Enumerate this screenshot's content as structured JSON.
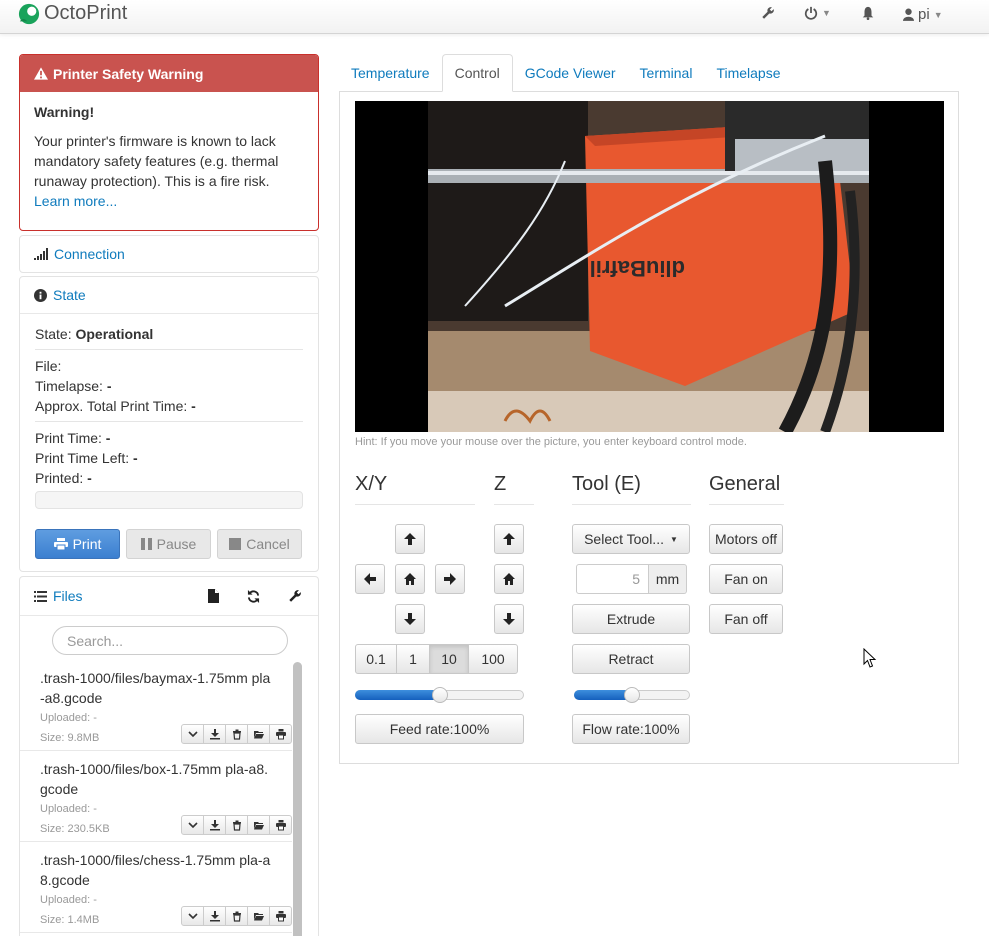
{
  "navbar": {
    "brand": "OctoPrint",
    "user": "pi"
  },
  "alert": {
    "title": "Printer Safety Warning",
    "heading": "Warning!",
    "body": "Your printer's firmware is known to lack mandatory safety features (e.g. thermal runaway protection). This is a fire risk.",
    "link": "Learn more..."
  },
  "connection": {
    "label": "Connection"
  },
  "state": {
    "label": "State",
    "state_label": "State:",
    "state_value": "Operational",
    "file_label": "File:",
    "timelapse_label": "Timelapse:",
    "timelapse_value": "-",
    "approx_label": "Approx. Total Print Time:",
    "approx_value": "-",
    "print_time_label": "Print Time:",
    "print_time_value": "-",
    "time_left_label": "Print Time Left:",
    "time_left_value": "-",
    "printed_label": "Printed:",
    "printed_value": "-",
    "buttons": {
      "print": "Print",
      "pause": "Pause",
      "cancel": "Cancel"
    }
  },
  "files": {
    "label": "Files",
    "search_placeholder": "Search...",
    "items": [
      {
        "name": ".trash-1000/files/baymax-1.75mm pla-a8.gcode",
        "uploaded": "Uploaded: -",
        "size": "Size: 9.8MB"
      },
      {
        "name": ".trash-1000/files/box-1.75mm pla-a8.gcode",
        "uploaded": "Uploaded: -",
        "size": "Size: 230.5KB"
      },
      {
        "name": ".trash-1000/files/chess-1.75mm pla-a8.gcode",
        "uploaded": "Uploaded: -",
        "size": "Size: 1.4MB"
      }
    ]
  },
  "tabs": [
    "Temperature",
    "Control",
    "GCode Viewer",
    "Terminal",
    "Timelapse"
  ],
  "active_tab": "Control",
  "control": {
    "hint": "Hint: If you move your mouse over the picture, you enter keyboard control mode.",
    "xy_title": "X/Y",
    "z_title": "Z",
    "tool_title": "Tool (E)",
    "general_title": "General",
    "step_options": [
      "0.1",
      "1",
      "10",
      "100"
    ],
    "step_selected": "10",
    "feed_rate_label": "Feed rate:100%",
    "feed_rate_fraction": 0.5,
    "flow_rate_label": "Flow rate:100%",
    "flow_rate_fraction": 0.5,
    "select_tool": "Select Tool...",
    "extrude_amount": "5",
    "extrude_unit": "mm",
    "extrude": "Extrude",
    "retract": "Retract",
    "motors_off": "Motors off",
    "fan_on": "Fan on",
    "fan_off": "Fan off"
  },
  "colors": {
    "accent": "#0f7bbd",
    "alert": "#c9534f",
    "primary_button": "#428bca",
    "webcam_plate": "#e8582f"
  },
  "icons": [
    "octoprint-logo",
    "wrench-icon",
    "power-icon",
    "bell-icon",
    "user-icon",
    "warning-icon",
    "signal-icon",
    "info-icon",
    "print-icon",
    "pause-icon",
    "stop-icon",
    "list-icon",
    "file-icon",
    "refresh-icon",
    "arrow-up-icon",
    "arrow-down-icon",
    "arrow-left-icon",
    "arrow-right-icon",
    "home-icon",
    "chevron-down-icon",
    "download-icon",
    "trash-icon",
    "folder-open-icon",
    "mouse-cursor-icon"
  ]
}
